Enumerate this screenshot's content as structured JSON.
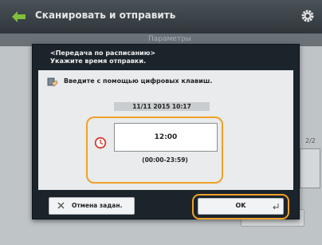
{
  "header": {
    "title": "Сканировать и отправить",
    "back_icon": "back-arrow-icon",
    "settings_icon": "gear-icon"
  },
  "subheader": {
    "label": "Параметры"
  },
  "background": {
    "side_counter": "2/2"
  },
  "dialog": {
    "message_line1": "<Передача по расписанию>",
    "message_line2": "Укажите время отправки.",
    "instruction": "Введите с помощью цифровых клавиш.",
    "current_datetime": "11/11 2015 10:17",
    "time_value": "12:00",
    "time_range": "(00:00-23:59)",
    "cancel_label": "Отмена задан.",
    "ok_label": "OK"
  },
  "colors": {
    "accent": "#f0a126",
    "dialog_bg": "#1c242b",
    "header_bg": "#3a4247"
  }
}
